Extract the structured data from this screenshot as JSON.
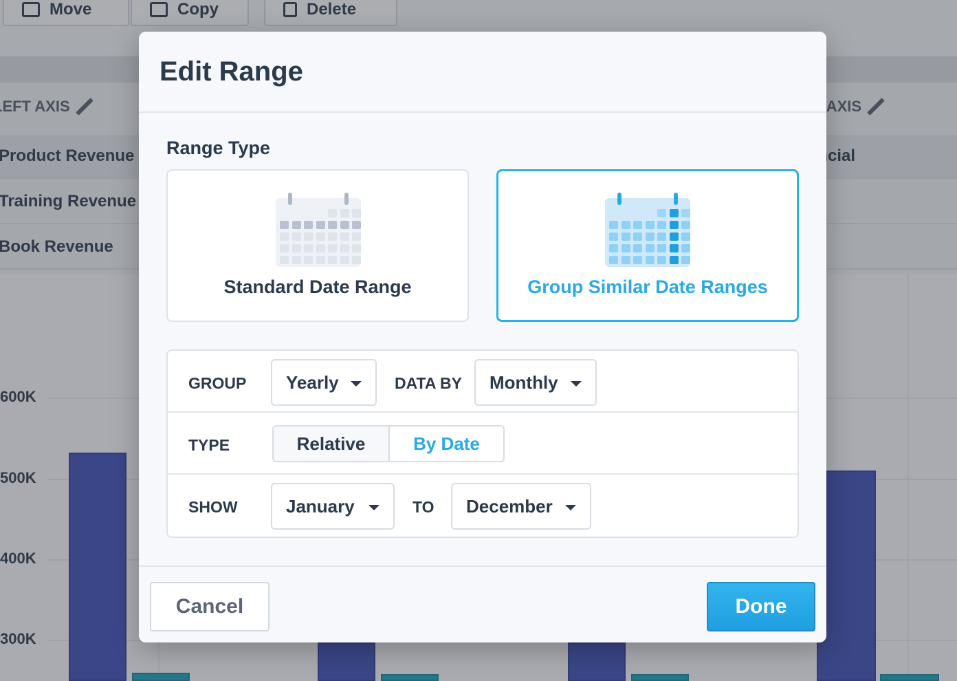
{
  "background": {
    "toolbar": {
      "move_label": "Move",
      "copy_label": "Copy",
      "delete_label": "Delete"
    },
    "left_axis_label": "LEFT AXIS",
    "right_axis_label": "RIGHT AXIS",
    "rows": [
      {
        "left": "Product Revenue",
        "right": "Financial"
      },
      {
        "left": "Training Revenue",
        "right": ""
      },
      {
        "left": "Book Revenue",
        "right": ""
      }
    ],
    "y_ticks": [
      "600K",
      "500K",
      "400K",
      "300K"
    ],
    "colors": {
      "series_revenue": "#3d4fb5",
      "series_other": "#1aa3b8"
    }
  },
  "dialog": {
    "title": "Edit Range",
    "range_type_label": "Range Type",
    "range_types": [
      {
        "label": "Standard Date Range",
        "selected": false,
        "icon": "calendar-icon"
      },
      {
        "label": "Group Similar Date Ranges",
        "selected": true,
        "icon": "calendar-grouped-icon"
      }
    ],
    "options": {
      "group_label": "GROUP",
      "group_value": "Yearly",
      "data_by_label": "DATA BY",
      "data_by_value": "Monthly",
      "type_label": "TYPE",
      "type_options": [
        "Relative",
        "By Date"
      ],
      "type_selected": "By Date",
      "show_label": "SHOW",
      "show_from": "January",
      "to_label": "TO",
      "show_to": "December"
    },
    "cancel_label": "Cancel",
    "done_label": "Done",
    "accent_color": "#2aa9e6"
  }
}
